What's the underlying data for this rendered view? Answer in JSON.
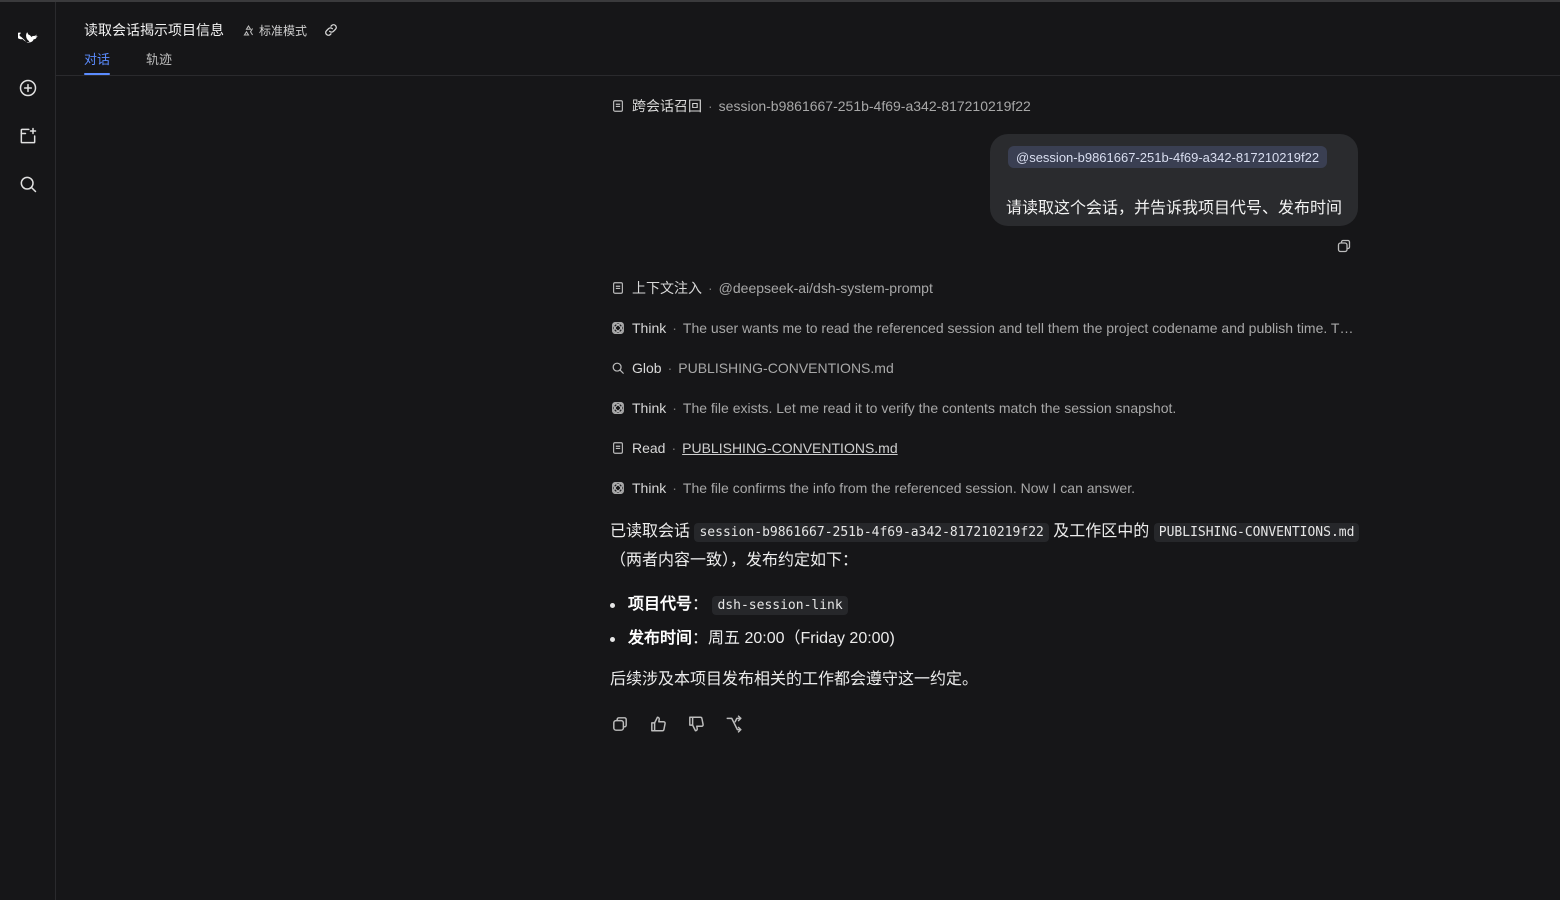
{
  "header": {
    "title": "读取会话揭示项目信息",
    "mode_label": "标准模式",
    "tabs": [
      "对话",
      "轨迹"
    ]
  },
  "sidebar": {
    "icons": [
      "logo-icon",
      "new-chat-icon",
      "new-project-icon",
      "search-icon"
    ]
  },
  "conversation": {
    "recall_step": {
      "label": "跨会话召回",
      "detail": "session-b9861667-251b-4f69-a342-817210219f22"
    },
    "user_message": {
      "mention": "@session-b9861667-251b-4f69-a342-817210219f22",
      "text": "请读取这个会话，并告诉我项目代号、发布时间"
    },
    "steps": [
      {
        "icon": "doc-icon",
        "label": "上下文注入",
        "detail": "@deepseek-ai/dsh-system-prompt"
      },
      {
        "icon": "think-icon",
        "label": "Think",
        "detail": "The user wants me to read the referenced session and tell them the project codename and publish time. Th..."
      },
      {
        "icon": "search-icon",
        "label": "Glob",
        "detail": "PUBLISHING-CONVENTIONS.md"
      },
      {
        "icon": "think-icon",
        "label": "Think",
        "detail": "The file exists. Let me read it to verify the contents match the session snapshot."
      },
      {
        "icon": "doc-icon",
        "label": "Read",
        "detail": "PUBLISHING-CONVENTIONS.md"
      },
      {
        "icon": "think-icon",
        "label": "Think",
        "detail": "The file confirms the info from the referenced session. Now I can answer."
      }
    ],
    "answer": {
      "p1_prefix": "已读取会话",
      "p1_code1": "session-b9861667-251b-4f69-a342-817210219f22",
      "p1_mid": "及工作区中的",
      "p1_code2": "PUBLISHING-CONVENTIONS.md",
      "p1_suffix": "（两者内容一致），发布约定如下：",
      "items": [
        {
          "key": "项目代号",
          "sep": "：",
          "code": "dsh-session-link"
        },
        {
          "key": "发布时间",
          "sep": "：",
          "text": "周五 20:00（Friday 20:00)"
        }
      ],
      "p2": "后续涉及本项目发布相关的工作都会遵守这一约定。"
    }
  }
}
